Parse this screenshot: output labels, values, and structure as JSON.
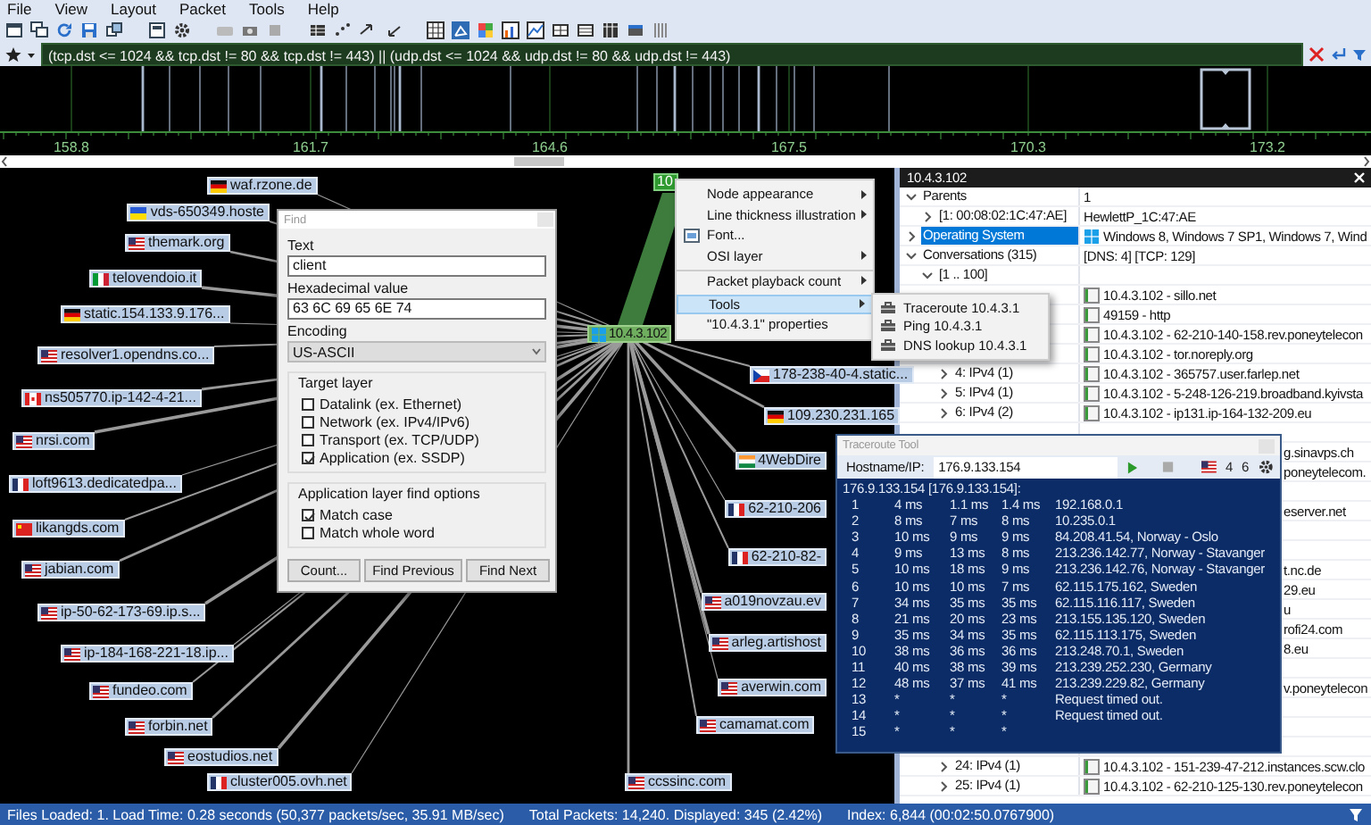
{
  "menu_bar": [
    "File",
    "View",
    "Layout",
    "Packet",
    "Tools",
    "Help"
  ],
  "filter": {
    "value": "(tcp.dst <= 1024 && tcp.dst != 80 && tcp.dst != 443) || (udp.dst <= 1024 && udp.dst != 80 && udp.dst != 443)"
  },
  "timeline": {
    "tick_labels": [
      "158.8",
      "161.7",
      "164.6",
      "167.5",
      "170.3",
      "173.2"
    ]
  },
  "graph": {
    "center_node": {
      "label": "10.4.3.102"
    },
    "top_node": {
      "label": "10"
    },
    "nodes": [
      {
        "label": "waf.rzone.de",
        "kind": "germany"
      },
      {
        "label": "vds-650349.hoste",
        "kind": "ukraine"
      },
      {
        "label": "themark.org",
        "kind": "usa"
      },
      {
        "label": "telovendoio.it",
        "kind": "italy"
      },
      {
        "label": "static.154.133.9.176...",
        "kind": "germany"
      },
      {
        "label": "resolver1.opendns.co...",
        "kind": "usa"
      },
      {
        "label": "ns505770.ip-142-4-21...",
        "kind": "canada"
      },
      {
        "label": "nrsi.com",
        "kind": "usa"
      },
      {
        "label": "loft9613.dedicatedpa...",
        "kind": "france"
      },
      {
        "label": "likangds.com",
        "kind": "china"
      },
      {
        "label": "jabian.com",
        "kind": "usa"
      },
      {
        "label": "ip-50-62-173-69.ip.s...",
        "kind": "usa"
      },
      {
        "label": "ip-184-168-221-18.ip...",
        "kind": "usa"
      },
      {
        "label": "fundeo.com",
        "kind": "usa"
      },
      {
        "label": "forbin.net",
        "kind": "usa"
      },
      {
        "label": "eostudios.net",
        "kind": "usa"
      },
      {
        "label": "cluster005.ovh.net",
        "kind": "france"
      },
      {
        "label": "178-238-40-4.static...",
        "kind": "czechia"
      },
      {
        "label": "109.230.231.165",
        "kind": "germany"
      },
      {
        "label": "4WebDire",
        "kind": "india"
      },
      {
        "label": "62-210-206",
        "kind": "france"
      },
      {
        "label": "62-210-82-",
        "kind": "france"
      },
      {
        "label": "a019novzau.ev",
        "kind": "usa"
      },
      {
        "label": "arleg.artishost",
        "kind": "usa"
      },
      {
        "label": "averwin.com",
        "kind": "usa"
      },
      {
        "label": "camamat.com",
        "kind": "usa"
      },
      {
        "label": "ccssinc.com",
        "kind": "usa"
      }
    ]
  },
  "find_dialog": {
    "title": "Find",
    "text_label": "Text",
    "text_value": "client",
    "hex_label": "Hexadecimal value",
    "hex_value": "63 6C 69 65 6E 74",
    "encoding_label": "Encoding",
    "encoding": "US-ASCII",
    "target_layer": {
      "title": "Target layer",
      "options": [
        {
          "label": "Datalink (ex. Ethernet)",
          "checked": false
        },
        {
          "label": "Network (ex. IPv4/IPv6)",
          "checked": false
        },
        {
          "label": "Transport (ex. TCP/UDP)",
          "checked": false
        },
        {
          "label": "Application (ex. SSDP)",
          "checked": true
        }
      ]
    },
    "app_options": {
      "title": "Application layer find options",
      "options": [
        {
          "label": "Match case",
          "checked": true
        },
        {
          "label": "Match whole word",
          "checked": false
        }
      ]
    },
    "buttons": [
      "Count...",
      "Find Previous",
      "Find Next"
    ]
  },
  "context_menu": {
    "items": [
      {
        "label": "Node appearance",
        "submenu": true,
        "icon": false,
        "separator_before": false,
        "selected": false
      },
      {
        "label": "Line thickness illustration",
        "submenu": true,
        "icon": false,
        "separator_before": false,
        "selected": false
      },
      {
        "label": "Font...",
        "submenu": false,
        "icon": true,
        "separator_before": false,
        "selected": false
      },
      {
        "label": "OSI layer",
        "submenu": true,
        "icon": false,
        "separator_before": false,
        "selected": false
      },
      {
        "label": "Packet playback count",
        "submenu": true,
        "icon": false,
        "separator_before": true,
        "selected": false
      },
      {
        "label": "Tools",
        "submenu": true,
        "icon": false,
        "separator_before": true,
        "selected": true
      },
      {
        "label": "\"10.4.3.1\" properties",
        "submenu": false,
        "icon": false,
        "separator_before": false,
        "selected": false
      }
    ],
    "submenu": {
      "items": [
        "Traceroute 10.4.3.1",
        "Ping 10.4.3.1",
        "DNS lookup 10.4.3.1"
      ]
    }
  },
  "details_panel": {
    "title": "10.4.3.102",
    "tree": [
      {
        "kind": "property",
        "label": "Parents",
        "value": "1",
        "expanded": true,
        "selected": false,
        "children": [
          {
            "kind": "property",
            "label": "[1: 00:08:02:1C:47:AE]",
            "value": "HewlettP_1C:47:AE",
            "expanded": false,
            "selected": false
          }
        ]
      },
      {
        "kind": "os_property",
        "label": "Operating System",
        "value": "Windows 8, Windows 7 SP1, Windows 7, Wind",
        "expanded": false,
        "selected": true
      },
      {
        "kind": "property",
        "label": "Conversations (315)",
        "value": "[DNS: 4] [TCP: 129]",
        "expanded": true,
        "selected": false,
        "children": [
          {
            "kind": "property",
            "label": "[1 .. 100]",
            "expanded": true,
            "selected": false,
            "children": [
              {
                "kind": "partly_covered",
                "value": "10.4.3.102 - sillo.net"
              },
              {
                "kind": "partly_covered",
                "value": "49159 - http"
              },
              {
                "kind": "partly_covered",
                "value": "10.4.3.102 - 62-210-140-158.rev.poneytelecon"
              },
              {
                "kind": "partly_covered",
                "value": "10.4.3.102 - tor.noreply.org"
              },
              {
                "kind": "conversation",
                "label": "4: IPv4 (1)",
                "value": "10.4.3.102 - 365757.user.farlep.net",
                "expanded": false,
                "selected": false
              },
              {
                "kind": "conversation",
                "label": "5: IPv4 (1)",
                "value": "10.4.3.102 - 5-248-126-219.broadband.kyivsta",
                "expanded": false,
                "selected": false
              },
              {
                "kind": "conversation",
                "label": "6: IPv4 (2)",
                "value": "10.4.3.102 - ip131.ip-164-132-209.eu",
                "expanded": false,
                "selected": false
              },
              {
                "kind": "covered"
              },
              {
                "kind": "covered",
                "value": "g.sinavps.ch"
              },
              {
                "kind": "covered",
                "value": "poneytelecom."
              },
              {
                "kind": "covered"
              },
              {
                "kind": "covered",
                "value": "eserver.net"
              },
              {
                "kind": "covered"
              },
              {
                "kind": "covered"
              },
              {
                "kind": "covered",
                "value": "t.nc.de"
              },
              {
                "kind": "covered",
                "value": "29.eu"
              },
              {
                "kind": "covered",
                "value": "u"
              },
              {
                "kind": "covered",
                "value": "rofi24.com"
              },
              {
                "kind": "covered",
                "value": "8.eu"
              },
              {
                "kind": "covered"
              },
              {
                "kind": "covered",
                "value": "v.poneytelecon"
              },
              {
                "kind": "covered"
              },
              {
                "kind": "covered"
              },
              {
                "kind": "covered"
              },
              {
                "kind": "conversation",
                "label": "24: IPv4 (1)",
                "value": "10.4.3.102 - 151-239-47-212.instances.scw.clo",
                "expanded": false,
                "selected": false
              },
              {
                "kind": "conversation",
                "label": "25: IPv4 (1)",
                "value": "10.4.3.102 - 62-210-125-130.rev.poneytelecon",
                "expanded": false,
                "selected": false
              }
            ]
          }
        ]
      }
    ]
  },
  "traceroute_tool": {
    "title": "Traceroute Tool",
    "hostname_label": "Hostname/IP:",
    "hostname": "176.9.133.154",
    "ipv4": "4",
    "ipv6": "6",
    "output_header": "176.9.133.154 [176.9.133.154]:",
    "hops": [
      {
        "hop": "1",
        "t1": "4 ms",
        "t2": "1.1 ms",
        "t3": "1.4 ms",
        "address": "192.168.0.1"
      },
      {
        "hop": "2",
        "t1": "8 ms",
        "t2": "7 ms",
        "t3": "8 ms",
        "address": "10.235.0.1"
      },
      {
        "hop": "3",
        "t1": "10 ms",
        "t2": "9 ms",
        "t3": "9 ms",
        "address": "84.208.41.54, Norway - Oslo"
      },
      {
        "hop": "4",
        "t1": "9 ms",
        "t2": "13 ms",
        "t3": "8 ms",
        "address": "213.236.142.77, Norway - Stavanger"
      },
      {
        "hop": "5",
        "t1": "10 ms",
        "t2": "18 ms",
        "t3": "9 ms",
        "address": "213.236.142.76, Norway - Stavanger"
      },
      {
        "hop": "6",
        "t1": "10 ms",
        "t2": "10 ms",
        "t3": "7 ms",
        "address": "62.115.175.162, Sweden"
      },
      {
        "hop": "7",
        "t1": "34 ms",
        "t2": "35 ms",
        "t3": "35 ms",
        "address": "62.115.116.117, Sweden"
      },
      {
        "hop": "8",
        "t1": "21 ms",
        "t2": "20 ms",
        "t3": "23 ms",
        "address": "213.155.135.120, Sweden"
      },
      {
        "hop": "9",
        "t1": "35 ms",
        "t2": "34 ms",
        "t3": "35 ms",
        "address": "62.115.113.175, Sweden"
      },
      {
        "hop": "10",
        "t1": "38 ms",
        "t2": "36 ms",
        "t3": "36 ms",
        "address": "213.248.70.1, Sweden"
      },
      {
        "hop": "11",
        "t1": "40 ms",
        "t2": "38 ms",
        "t3": "39 ms",
        "address": "213.239.252.230, Germany"
      },
      {
        "hop": "12",
        "t1": "48 ms",
        "t2": "37 ms",
        "t3": "41 ms",
        "address": "213.239.229.82, Germany"
      },
      {
        "hop": "13",
        "t1": "*",
        "t2": "*",
        "t3": "*",
        "address": "Request timed out."
      },
      {
        "hop": "14",
        "t1": "*",
        "t2": "*",
        "t3": "*",
        "address": "Request timed out."
      },
      {
        "hop": "15",
        "t1": "*",
        "t2": "*",
        "t3": "*"
      }
    ]
  },
  "status_bar": {
    "load": "Files Loaded: 1. Load Time: 0.28 seconds (50,377 packets/sec, 35.91 MB/sec)",
    "packets": "Total Packets: 14,240. Displayed: 345 (2.42%)",
    "index": "Index: 6,844 (00:02:50.0767900)"
  }
}
